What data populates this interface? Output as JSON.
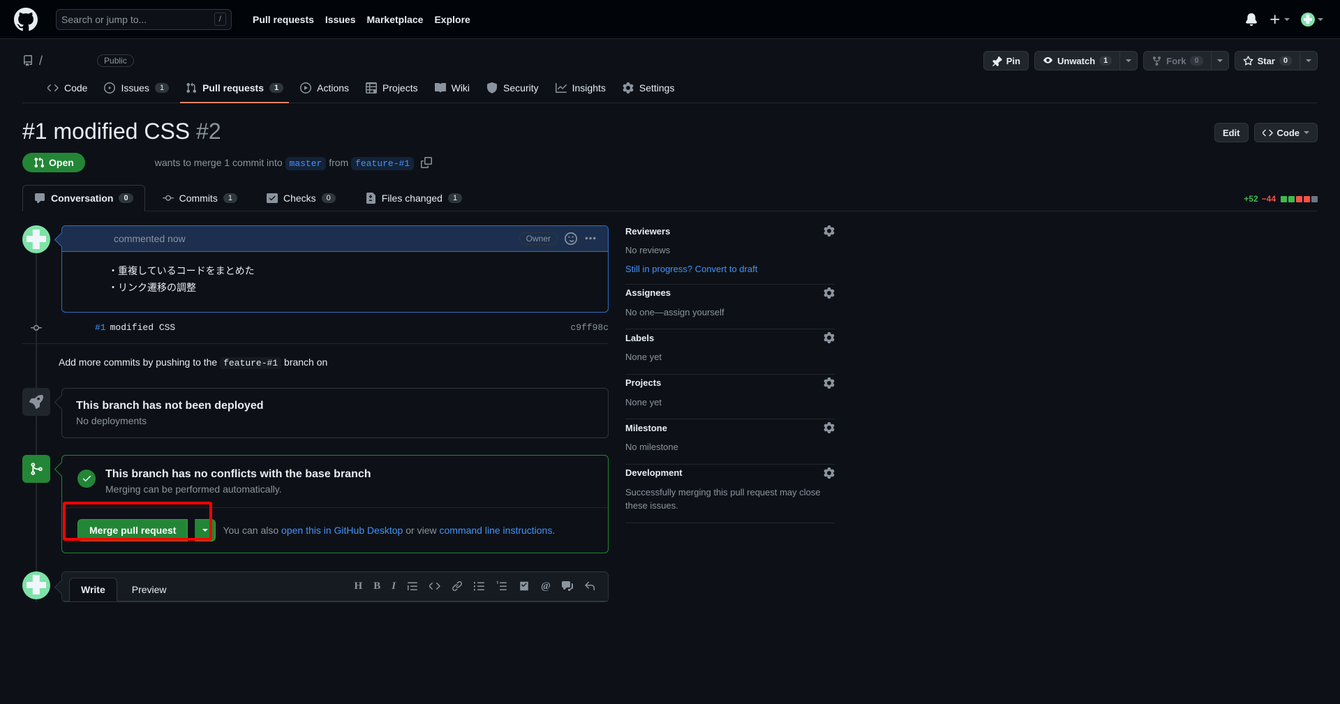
{
  "header": {
    "logo_icon": "github-mark-icon",
    "search": {
      "placeholder": "Search or jump to...",
      "shortcut": "/"
    },
    "nav": [
      {
        "label": "Pull requests"
      },
      {
        "label": "Issues"
      },
      {
        "label": "Marketplace"
      },
      {
        "label": "Explore"
      }
    ],
    "notifications_icon": "bell-icon",
    "create_icon": "plus-icon",
    "avatar_icon": "user-avatar"
  },
  "repo": {
    "book_icon": "repo-book-icon",
    "separator": "/",
    "visibility": "Public",
    "actions": {
      "pin": {
        "label": "Pin",
        "icon": "pin-icon"
      },
      "unwatch": {
        "label": "Unwatch",
        "count": "1",
        "icon": "eye-icon"
      },
      "fork": {
        "label": "Fork",
        "count": "0",
        "icon": "fork-icon"
      },
      "star": {
        "label": "Star",
        "count": "0",
        "icon": "star-icon"
      }
    },
    "tabs": [
      {
        "label": "Code",
        "icon": "code-icon",
        "count": ""
      },
      {
        "label": "Issues",
        "icon": "issue-opened-icon",
        "count": "1"
      },
      {
        "label": "Pull requests",
        "icon": "git-pull-request-icon",
        "count": "1",
        "active": true
      },
      {
        "label": "Actions",
        "icon": "play-icon",
        "count": ""
      },
      {
        "label": "Projects",
        "icon": "table-icon",
        "count": ""
      },
      {
        "label": "Wiki",
        "icon": "book-icon",
        "count": ""
      },
      {
        "label": "Security",
        "icon": "shield-icon",
        "count": ""
      },
      {
        "label": "Insights",
        "icon": "graph-icon",
        "count": ""
      },
      {
        "label": "Settings",
        "icon": "gear-icon",
        "count": ""
      }
    ]
  },
  "pr": {
    "title": "#1 modified CSS",
    "number": "#2",
    "edit_label": "Edit",
    "code_label": "Code",
    "state": "Open",
    "state_icon": "git-pull-request-icon",
    "merge_desc_prefix": "wants to merge 1 commit into",
    "base_branch": "master",
    "merge_desc_mid": "from",
    "head_branch": "feature-#1",
    "copy_icon": "copy-icon",
    "tabs": [
      {
        "label": "Conversation",
        "count": "0",
        "icon": "comment-icon",
        "active": true
      },
      {
        "label": "Commits",
        "count": "1",
        "icon": "commit-icon",
        "active": false
      },
      {
        "label": "Checks",
        "count": "0",
        "icon": "checks-icon",
        "active": false
      },
      {
        "label": "Files changed",
        "count": "1",
        "icon": "file-diff-icon",
        "active": false
      }
    ],
    "diffstat": {
      "additions": "+52",
      "deletions": "−44",
      "blocks": [
        "#3fb950",
        "#3fb950",
        "#f85149",
        "#f85149",
        "#6e7681"
      ]
    }
  },
  "comment": {
    "author": "",
    "when": "commented now",
    "owner_badge": "Owner",
    "reaction_icon": "smiley-icon",
    "menu_icon": "kebab-horizontal-icon",
    "body_line1": "・重複しているコードをまとめた",
    "body_line2": "・リンク遷移の調整"
  },
  "timeline": {
    "commit_link": "#1",
    "commit_message": "modified CSS",
    "commit_sha": "c9ff98c",
    "commit_dot_icon": "commit-dot-icon",
    "push_note_prefix": "Add more commits by pushing to the",
    "push_note_branch": "feature-#1",
    "push_note_suffix": "branch on"
  },
  "deployment": {
    "icon": "rocket-icon",
    "title": "This branch has not been deployed",
    "subtitle": "No deployments"
  },
  "merge": {
    "icon": "git-merge-icon",
    "check_icon": "check-icon",
    "title": "This branch has no conflicts with the base branch",
    "subtitle": "Merging can be performed automatically.",
    "button_label": "Merge pull request",
    "dropdown_icon": "chevron-down-icon",
    "note_prefix": "You can also",
    "note_link1": "open this in GitHub Desktop",
    "note_mid": "or view",
    "note_link2": "command line instructions",
    "note_suffix": ".",
    "highlight_color": "#ff0000"
  },
  "write_box": {
    "tabs": [
      {
        "label": "Write",
        "active": true
      },
      {
        "label": "Preview",
        "active": false
      }
    ],
    "tools": [
      {
        "icon": "heading-icon",
        "glyph": "H"
      },
      {
        "icon": "bold-icon",
        "glyph": "B"
      },
      {
        "icon": "italic-icon",
        "glyph": "I"
      },
      {
        "icon": "quote-icon",
        "glyph": ""
      },
      {
        "icon": "code-icon",
        "glyph": ""
      },
      {
        "icon": "link-icon",
        "glyph": ""
      },
      {
        "icon": "unordered-list-icon",
        "glyph": ""
      },
      {
        "icon": "ordered-list-icon",
        "glyph": ""
      },
      {
        "icon": "task-list-icon",
        "glyph": ""
      },
      {
        "icon": "mention-icon",
        "glyph": "@"
      },
      {
        "icon": "reference-icon",
        "glyph": ""
      },
      {
        "icon": "reply-icon",
        "glyph": ""
      }
    ]
  },
  "sidebar": [
    {
      "title": "Reviewers",
      "gear_icon": "gear-icon",
      "lines": [
        "No reviews"
      ],
      "link": "Still in progress? Convert to draft"
    },
    {
      "title": "Assignees",
      "gear_icon": "gear-icon",
      "lines": [
        "No one—assign yourself"
      ],
      "link": ""
    },
    {
      "title": "Labels",
      "gear_icon": "gear-icon",
      "lines": [
        "None yet"
      ],
      "link": ""
    },
    {
      "title": "Projects",
      "gear_icon": "gear-icon",
      "lines": [
        "None yet"
      ],
      "link": ""
    },
    {
      "title": "Milestone",
      "gear_icon": "gear-icon",
      "lines": [
        "No milestone"
      ],
      "link": ""
    },
    {
      "title": "Development",
      "gear_icon": "gear-icon",
      "lines": [
        "Successfully merging this pull request may close these issues."
      ],
      "link": ""
    }
  ]
}
